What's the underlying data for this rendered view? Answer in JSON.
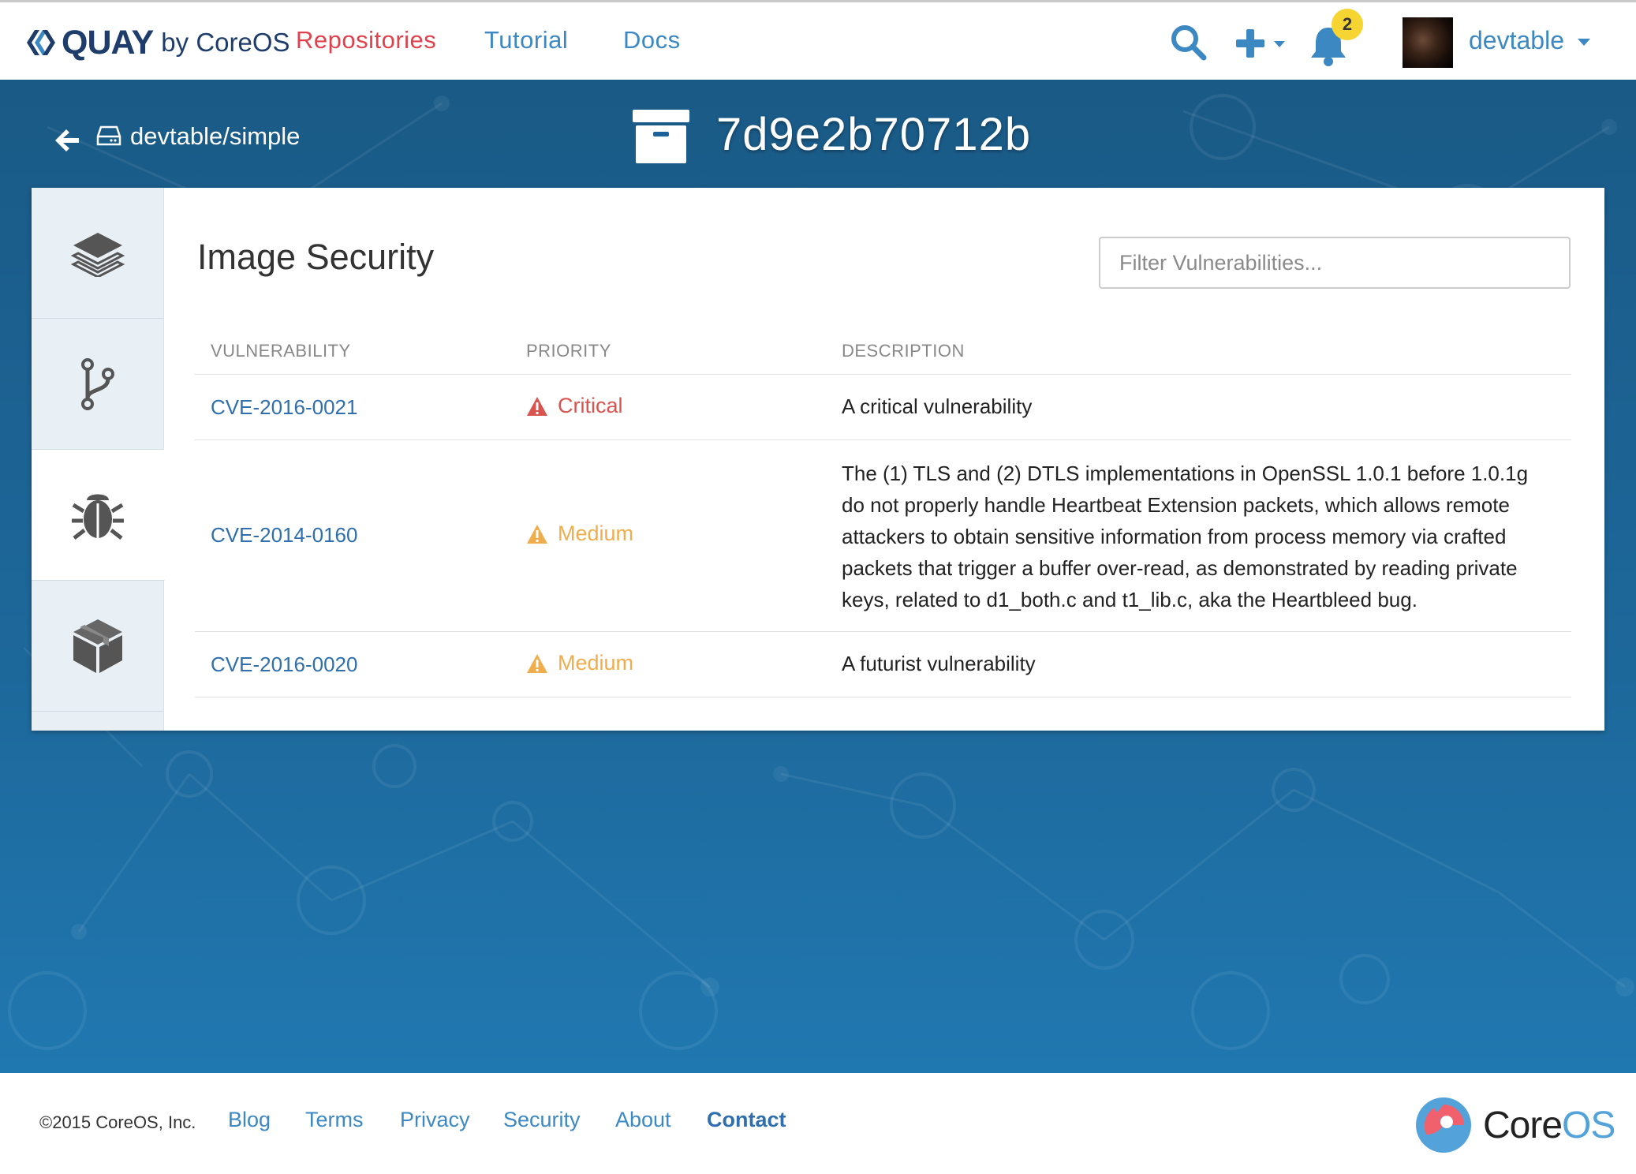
{
  "navbar": {
    "logo_word": "QUAY",
    "logo_by": "by CoreOS",
    "links": [
      "Repositories",
      "Tutorial",
      "Docs"
    ],
    "notification_count": "2",
    "username": "devtable"
  },
  "header": {
    "repo_link": "devtable/simple",
    "image_id": "7d9e2b70712b"
  },
  "side_tabs": [
    "layers-icon",
    "branch-icon",
    "bug-icon",
    "package-icon"
  ],
  "security": {
    "title": "Image Security",
    "filter_placeholder": "Filter Vulnerabilities...",
    "columns": [
      "VULNERABILITY",
      "PRIORITY",
      "DESCRIPTION"
    ],
    "rows": [
      {
        "cve": "CVE-2016-0021",
        "priority": "Critical",
        "description": "A critical vulnerability"
      },
      {
        "cve": "CVE-2014-0160",
        "priority": "Medium",
        "description": "The (1) TLS and (2) DTLS implementations in OpenSSL 1.0.1 before 1.0.1g do not properly handle Heartbeat Extension packets, which allows remote attackers to obtain sensitive information from process memory via crafted packets that trigger a buffer over-read, as demonstrated by reading private keys, related to d1_both.c and t1_lib.c, aka the Heartbleed bug."
      },
      {
        "cve": "CVE-2016-0020",
        "priority": "Medium",
        "description": "A futurist vulnerability"
      }
    ]
  },
  "footer": {
    "copyright": "©2015 CoreOS, Inc.",
    "links": [
      "Blog",
      "Terms",
      "Privacy",
      "Security",
      "About",
      "Contact"
    ],
    "brand_core": "Core",
    "brand_os": "OS"
  },
  "colors": {
    "brand_blue": "#1e3d6b",
    "link_blue": "#3b88c3",
    "active_red": "#e0424d",
    "critical": "#d9534f",
    "medium": "#f0ad4e",
    "hero_blue": "#1d689b",
    "badge_yellow": "#f6d431"
  }
}
